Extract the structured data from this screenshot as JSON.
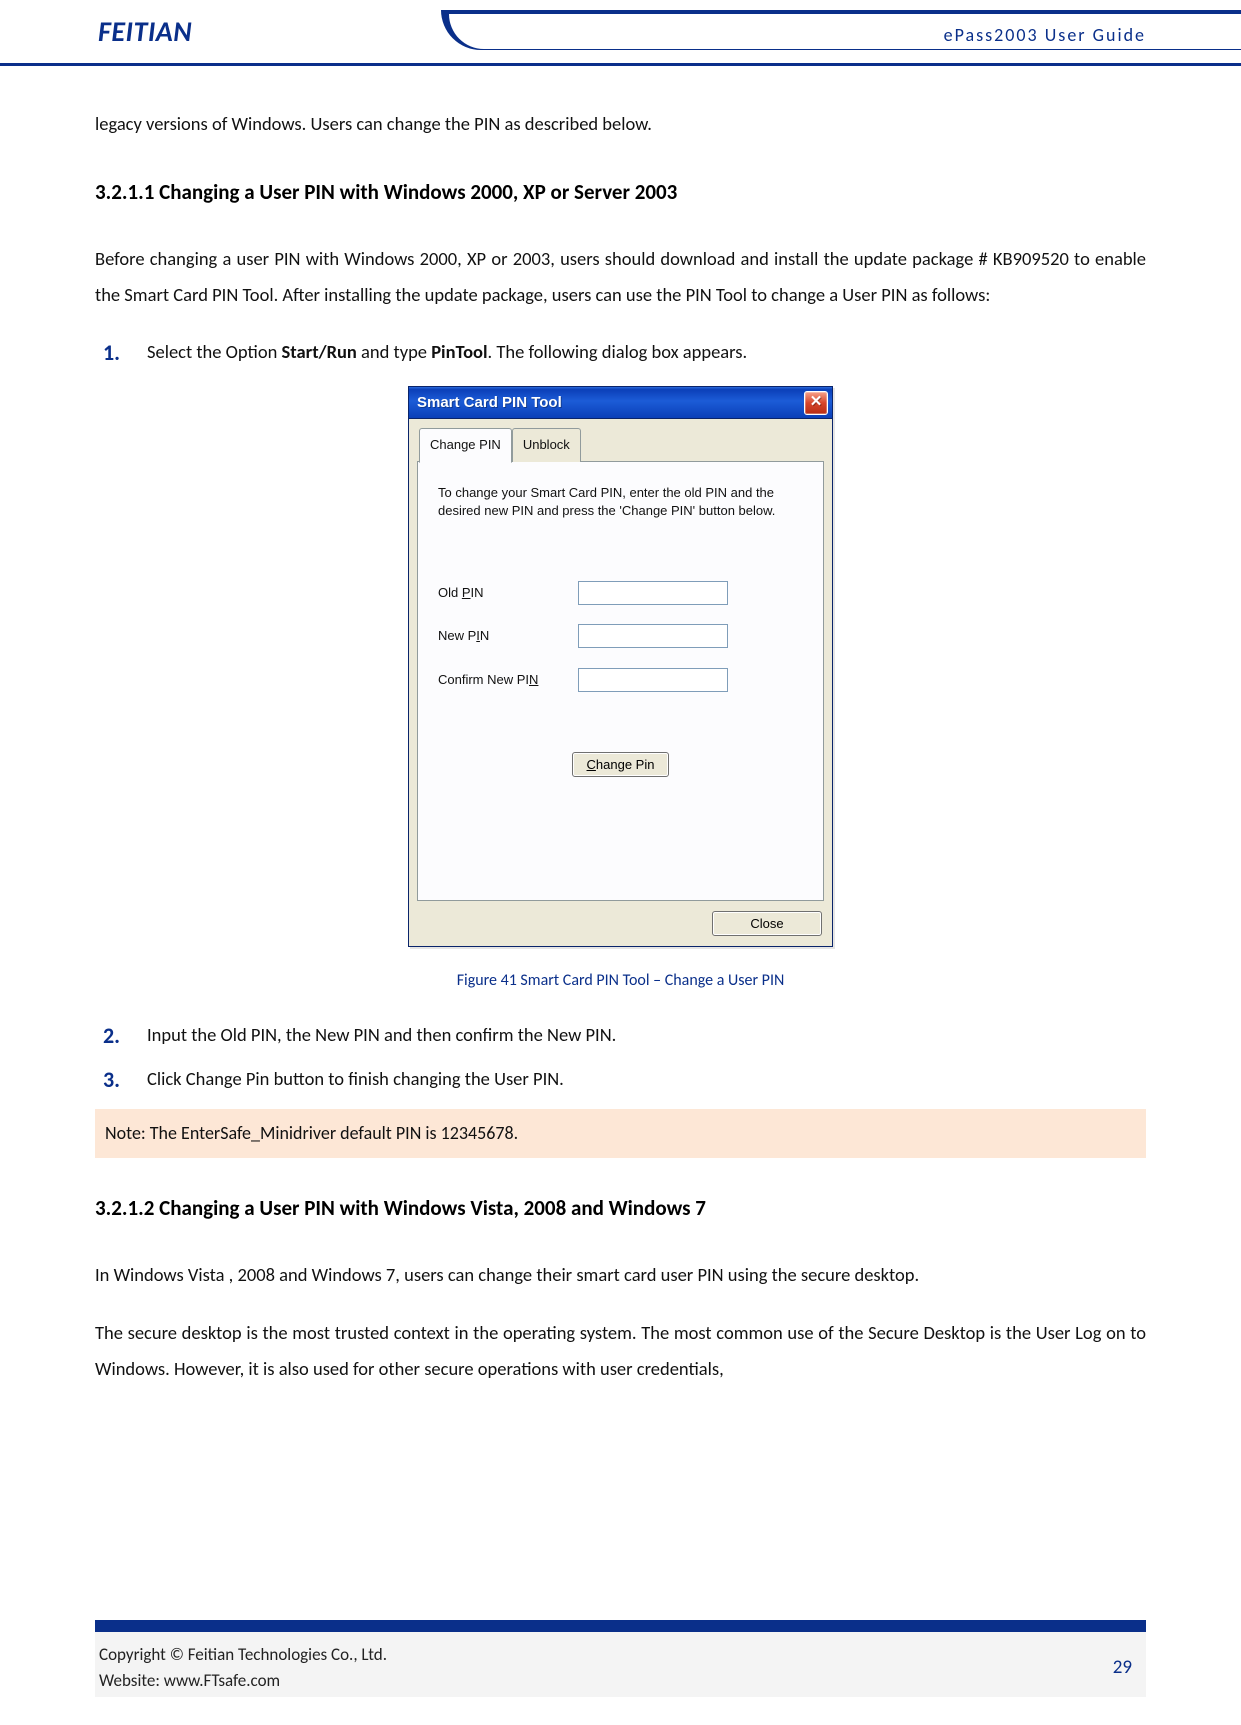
{
  "header": {
    "logo": "FEITIAN",
    "doc_title": "ePass2003  User  Guide"
  },
  "body": {
    "lead_in": "legacy versions of Windows. Users can change the PIN as described below.",
    "section1_heading": "3.2.1.1 Changing a User PIN with Windows 2000, XP or Server 2003",
    "section1_para": "Before changing a user PIN with Windows 2000, XP or 2003, users should download and install the update package # KB909520 to enable the Smart Card PIN Tool. After installing the update package, users can use the PIN Tool to change a User PIN as follows:",
    "steps1": {
      "s1_pre": "Select the Option ",
      "s1_b1": "Start/Run",
      "s1_mid": " and type ",
      "s1_b2": "PinTool",
      "s1_post": ". The following dialog box appears.",
      "s2": "Input the Old PIN, the New PIN and then confirm the New PIN.",
      "s3": "Click Change Pin button to finish changing the User PIN."
    },
    "figure_caption": "Figure 41 Smart Card PIN Tool – Change a User PIN",
    "note": "Note: The EnterSafe_Minidriver default PIN is 12345678.",
    "section2_heading": "3.2.1.2 Changing a User PIN with Windows Vista, 2008 and Windows 7",
    "section2_p1": "In Windows Vista , 2008 and Windows 7, users can change their smart card user PIN using the secure desktop.",
    "section2_p2": "The secure desktop is the most trusted context in the operating system. The most common use of the Secure Desktop is the User Log on to Windows. However, it is also used for other secure operations with user credentials,"
  },
  "dialog": {
    "title": "Smart Card PIN Tool",
    "tab_change": "Change PIN",
    "tab_unblock": "Unblock",
    "instructions": "To change your Smart Card PIN, enter the old PIN and the desired new PIN and press the 'Change PIN' button below.",
    "label_old": "Old PIN",
    "label_new": "New PIN",
    "label_confirm": "Confirm New PIN",
    "btn_change": "Change Pin",
    "btn_close": "Close",
    "old_value": "",
    "new_value": "",
    "confirm_value": ""
  },
  "footer": {
    "copyright": "Copyright © Feitian Technologies Co., Ltd.",
    "website": "Website: www.FTsafe.com",
    "page_no": "29"
  }
}
